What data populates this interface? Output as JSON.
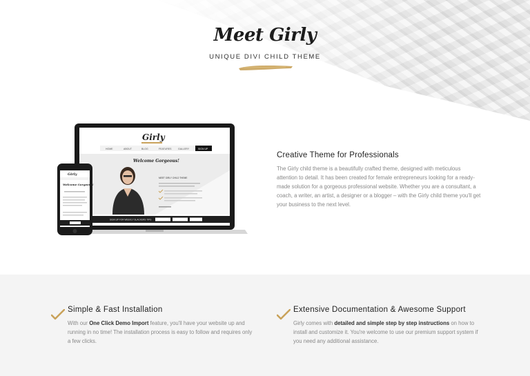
{
  "header": {
    "logo": "Meet Girly",
    "tagline": "UNIQUE DIVI CHILD THEME"
  },
  "mockup": {
    "site_logo": "Girly",
    "hero_script": "Welcome Gorgeous!",
    "phone_script": "Welcome Gorgeous!",
    "nav_items": [
      "HOME",
      "ABOUT",
      "BLOG",
      "FEATURES",
      "GALLERY",
      "SIGN UP"
    ],
    "section_label": "MEET GIRLY CHILD THEME",
    "cta_label": "SIGN UP FOR WEEKLY SLACKERS TIPS"
  },
  "feature": {
    "title": "Creative Theme for Professionals",
    "text": "The Girly child theme is a beautifully crafted theme, designed with meticulous attention to detail. It has been created for female entrepreneurs looking for a ready-made solution for a gorgeous professional website. Whether you are a consultant, a coach, a writer, an artist, a designer or a blogger – with the Girly child theme you'll get your business to the next level."
  },
  "benefits": [
    {
      "title": "Simple & Fast Installation",
      "pre": "With our ",
      "bold": "One Click Demo Import",
      "post": " feature, you'll have your website up and running in no time! The installation process is easy to follow and requires only a few clicks."
    },
    {
      "title": "Extensive Documentation & Awesome Support",
      "pre": "Girly comes with ",
      "bold": "detailed and simple step by step instructions",
      "post": " on how to install and customize it. You're welcome to use our premium support system if you need any additional assistance."
    }
  ],
  "colors": {
    "accent_gold": "#c9a25a",
    "band_bg": "#f4f4f4"
  },
  "icons": [
    "check-icon"
  ]
}
